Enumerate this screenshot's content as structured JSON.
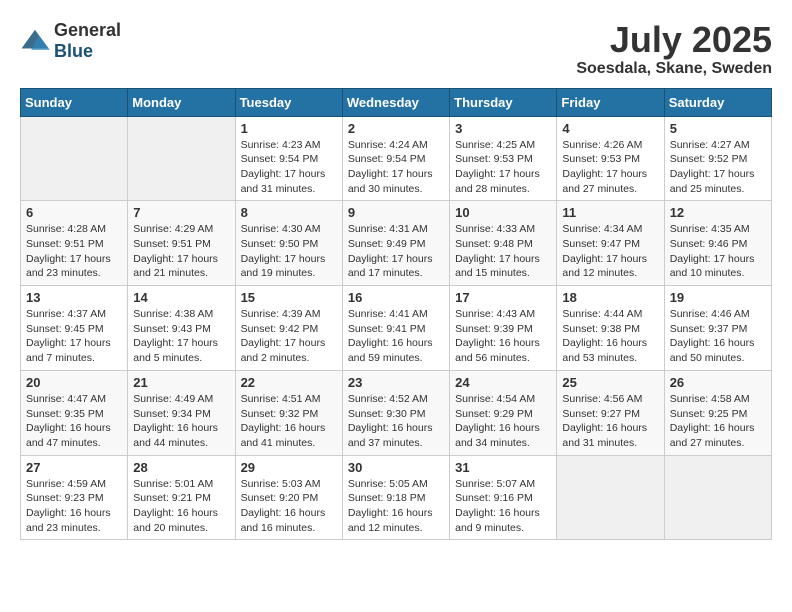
{
  "header": {
    "logo_general": "General",
    "logo_blue": "Blue",
    "month_year": "July 2025",
    "location": "Soesdala, Skane, Sweden"
  },
  "days_of_week": [
    "Sunday",
    "Monday",
    "Tuesday",
    "Wednesday",
    "Thursday",
    "Friday",
    "Saturday"
  ],
  "weeks": [
    [
      {
        "day": "",
        "info": ""
      },
      {
        "day": "",
        "info": ""
      },
      {
        "day": "1",
        "info": "Sunrise: 4:23 AM\nSunset: 9:54 PM\nDaylight: 17 hours and 31 minutes."
      },
      {
        "day": "2",
        "info": "Sunrise: 4:24 AM\nSunset: 9:54 PM\nDaylight: 17 hours and 30 minutes."
      },
      {
        "day": "3",
        "info": "Sunrise: 4:25 AM\nSunset: 9:53 PM\nDaylight: 17 hours and 28 minutes."
      },
      {
        "day": "4",
        "info": "Sunrise: 4:26 AM\nSunset: 9:53 PM\nDaylight: 17 hours and 27 minutes."
      },
      {
        "day": "5",
        "info": "Sunrise: 4:27 AM\nSunset: 9:52 PM\nDaylight: 17 hours and 25 minutes."
      }
    ],
    [
      {
        "day": "6",
        "info": "Sunrise: 4:28 AM\nSunset: 9:51 PM\nDaylight: 17 hours and 23 minutes."
      },
      {
        "day": "7",
        "info": "Sunrise: 4:29 AM\nSunset: 9:51 PM\nDaylight: 17 hours and 21 minutes."
      },
      {
        "day": "8",
        "info": "Sunrise: 4:30 AM\nSunset: 9:50 PM\nDaylight: 17 hours and 19 minutes."
      },
      {
        "day": "9",
        "info": "Sunrise: 4:31 AM\nSunset: 9:49 PM\nDaylight: 17 hours and 17 minutes."
      },
      {
        "day": "10",
        "info": "Sunrise: 4:33 AM\nSunset: 9:48 PM\nDaylight: 17 hours and 15 minutes."
      },
      {
        "day": "11",
        "info": "Sunrise: 4:34 AM\nSunset: 9:47 PM\nDaylight: 17 hours and 12 minutes."
      },
      {
        "day": "12",
        "info": "Sunrise: 4:35 AM\nSunset: 9:46 PM\nDaylight: 17 hours and 10 minutes."
      }
    ],
    [
      {
        "day": "13",
        "info": "Sunrise: 4:37 AM\nSunset: 9:45 PM\nDaylight: 17 hours and 7 minutes."
      },
      {
        "day": "14",
        "info": "Sunrise: 4:38 AM\nSunset: 9:43 PM\nDaylight: 17 hours and 5 minutes."
      },
      {
        "day": "15",
        "info": "Sunrise: 4:39 AM\nSunset: 9:42 PM\nDaylight: 17 hours and 2 minutes."
      },
      {
        "day": "16",
        "info": "Sunrise: 4:41 AM\nSunset: 9:41 PM\nDaylight: 16 hours and 59 minutes."
      },
      {
        "day": "17",
        "info": "Sunrise: 4:43 AM\nSunset: 9:39 PM\nDaylight: 16 hours and 56 minutes."
      },
      {
        "day": "18",
        "info": "Sunrise: 4:44 AM\nSunset: 9:38 PM\nDaylight: 16 hours and 53 minutes."
      },
      {
        "day": "19",
        "info": "Sunrise: 4:46 AM\nSunset: 9:37 PM\nDaylight: 16 hours and 50 minutes."
      }
    ],
    [
      {
        "day": "20",
        "info": "Sunrise: 4:47 AM\nSunset: 9:35 PM\nDaylight: 16 hours and 47 minutes."
      },
      {
        "day": "21",
        "info": "Sunrise: 4:49 AM\nSunset: 9:34 PM\nDaylight: 16 hours and 44 minutes."
      },
      {
        "day": "22",
        "info": "Sunrise: 4:51 AM\nSunset: 9:32 PM\nDaylight: 16 hours and 41 minutes."
      },
      {
        "day": "23",
        "info": "Sunrise: 4:52 AM\nSunset: 9:30 PM\nDaylight: 16 hours and 37 minutes."
      },
      {
        "day": "24",
        "info": "Sunrise: 4:54 AM\nSunset: 9:29 PM\nDaylight: 16 hours and 34 minutes."
      },
      {
        "day": "25",
        "info": "Sunrise: 4:56 AM\nSunset: 9:27 PM\nDaylight: 16 hours and 31 minutes."
      },
      {
        "day": "26",
        "info": "Sunrise: 4:58 AM\nSunset: 9:25 PM\nDaylight: 16 hours and 27 minutes."
      }
    ],
    [
      {
        "day": "27",
        "info": "Sunrise: 4:59 AM\nSunset: 9:23 PM\nDaylight: 16 hours and 23 minutes."
      },
      {
        "day": "28",
        "info": "Sunrise: 5:01 AM\nSunset: 9:21 PM\nDaylight: 16 hours and 20 minutes."
      },
      {
        "day": "29",
        "info": "Sunrise: 5:03 AM\nSunset: 9:20 PM\nDaylight: 16 hours and 16 minutes."
      },
      {
        "day": "30",
        "info": "Sunrise: 5:05 AM\nSunset: 9:18 PM\nDaylight: 16 hours and 12 minutes."
      },
      {
        "day": "31",
        "info": "Sunrise: 5:07 AM\nSunset: 9:16 PM\nDaylight: 16 hours and 9 minutes."
      },
      {
        "day": "",
        "info": ""
      },
      {
        "day": "",
        "info": ""
      }
    ]
  ]
}
